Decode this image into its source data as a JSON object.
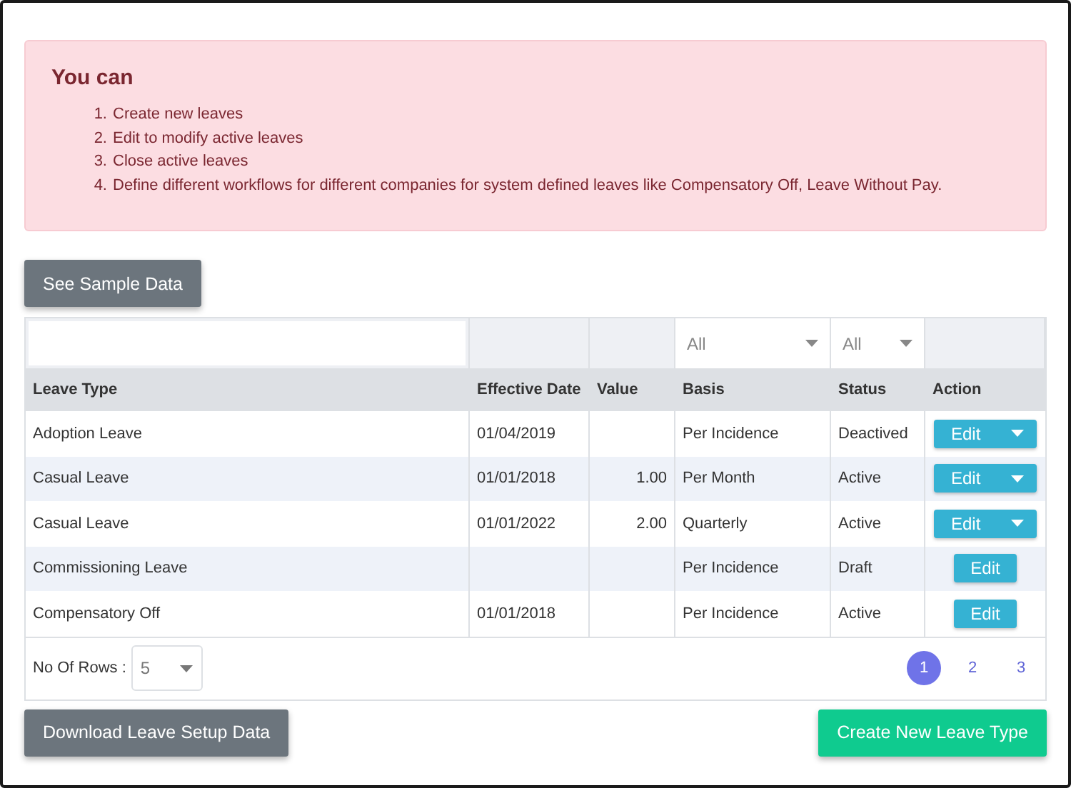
{
  "alert": {
    "title": "You can",
    "items": [
      {
        "marker": "1.",
        "text": "Create new leaves"
      },
      {
        "marker": "2.",
        "text": "Edit to modify active leaves"
      },
      {
        "marker": "3.",
        "text": "Close active leaves"
      },
      {
        "marker": "4.",
        "text": "Define different workflows for different companies for system defined leaves like Compensatory Off, Leave Without Pay."
      }
    ]
  },
  "sample_button": "See Sample Data",
  "table": {
    "filters": [
      {
        "kind": "text"
      },
      {
        "kind": "none"
      },
      {
        "kind": "none"
      },
      {
        "kind": "select",
        "value": "All"
      },
      {
        "kind": "select",
        "value": "All"
      },
      {
        "kind": "none"
      }
    ],
    "columns": [
      "Leave Type",
      "Effective Date",
      "Value",
      "Basis",
      "Status",
      "Action"
    ],
    "rows": [
      {
        "leave_type": "Adoption Leave",
        "effective_date": "01/04/2019",
        "value": "",
        "basis": "Per Incidence",
        "status": "Deactived",
        "action": {
          "kind": "split",
          "label": "Edit"
        }
      },
      {
        "leave_type": "Casual Leave",
        "effective_date": "01/01/2018",
        "value": "1.00",
        "basis": "Per Month",
        "status": "Active",
        "action": {
          "kind": "split",
          "label": "Edit"
        }
      },
      {
        "leave_type": "Casual Leave",
        "effective_date": "01/01/2022",
        "value": "2.00",
        "basis": "Quarterly",
        "status": "Active",
        "action": {
          "kind": "split",
          "label": "Edit"
        }
      },
      {
        "leave_type": "Commissioning Leave",
        "effective_date": "",
        "value": "",
        "basis": "Per Incidence",
        "status": "Draft",
        "action": {
          "kind": "plain",
          "label": "Edit"
        }
      },
      {
        "leave_type": "Compensatory Off",
        "effective_date": "01/01/2018",
        "value": "",
        "basis": "Per Incidence",
        "status": "Active",
        "action": {
          "kind": "plain",
          "label": "Edit"
        }
      }
    ],
    "rows_label": "No Of Rows :",
    "rows_value": "5",
    "pages": [
      {
        "label": "1",
        "selected": true
      },
      {
        "label": "2",
        "selected": false
      },
      {
        "label": "3",
        "selected": false
      }
    ]
  },
  "download_button": "Download Leave Setup Data",
  "create_button": "Create New Leave Type"
}
